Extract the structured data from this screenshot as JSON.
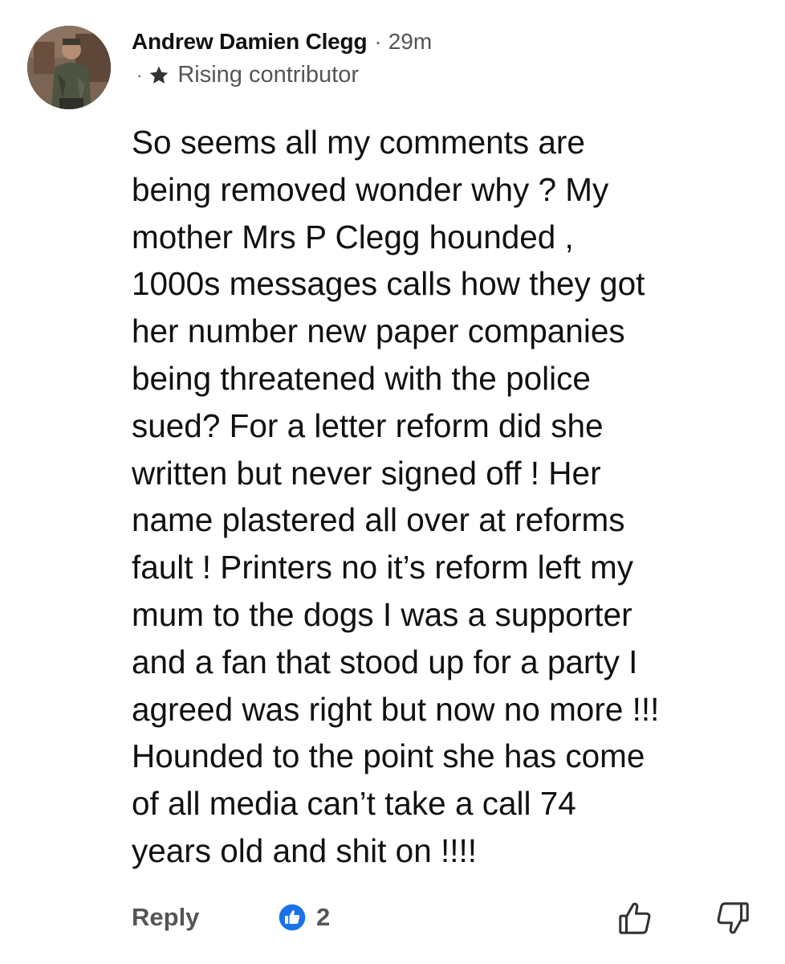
{
  "comment": {
    "author": "Andrew Damien Clegg",
    "separator": "·",
    "time_ago": "29m",
    "badge_separator": "·",
    "badge": "Rising contributor",
    "badge_icon": "star-icon",
    "body_lines": [
      "So seems all my comments are",
      "being removed wonder why ? My",
      "mother Mrs P Clegg hounded ,",
      "1000s messages calls how they got",
      "her number new paper companies",
      "being threatened with the police",
      "sued? For a letter reform did she",
      "written but never signed off ! Her",
      "name plastered all over at reforms",
      "fault ! Printers no it’s reform left my",
      "mum to the dogs I was a supporter",
      "and a fan that stood up for a party I",
      "agreed was right but now no more !!!",
      "Hounded to the point she has come",
      "of all media can’t take a call 74",
      "years old and shit on !!!!"
    ],
    "actions": {
      "reply_label": "Reply",
      "like_count": "2",
      "like_badge_icon": "thumbs-up-badge-icon",
      "upvote_icon": "thumbs-up-icon",
      "downvote_icon": "thumbs-down-icon"
    }
  },
  "colors": {
    "text": "#111111",
    "secondary_text": "#555555",
    "like_badge_blue": "#1a73e8",
    "background": "#ffffff"
  }
}
